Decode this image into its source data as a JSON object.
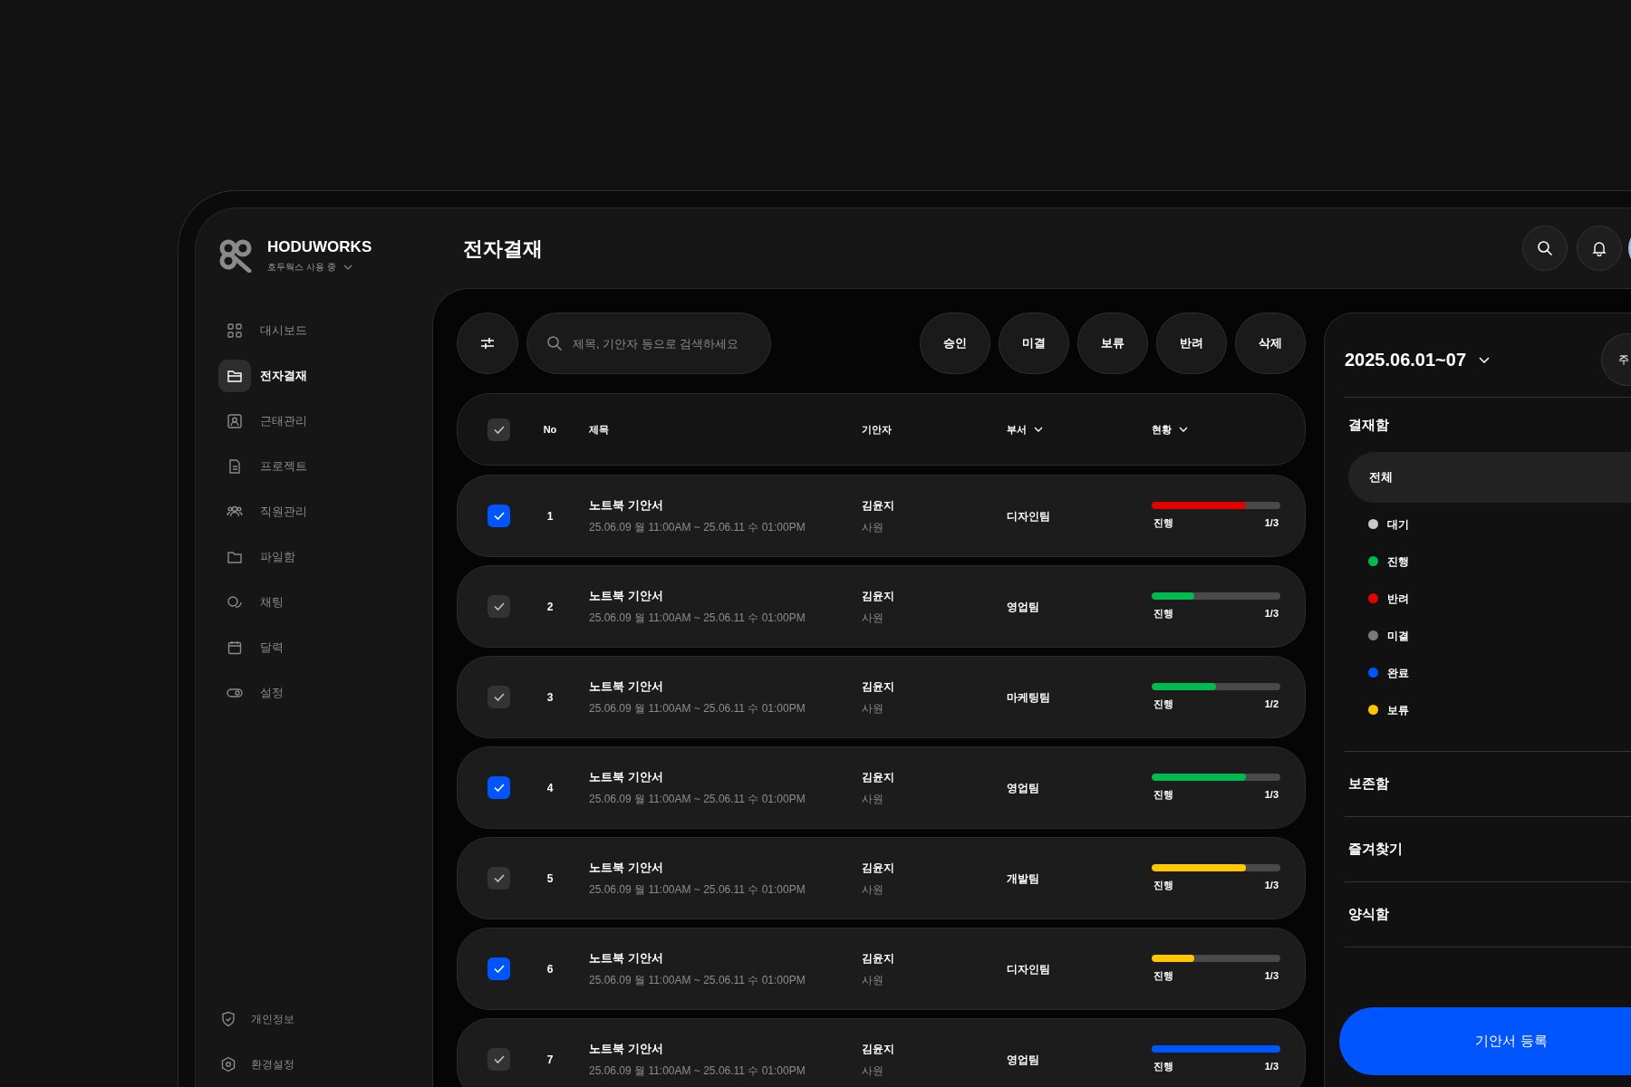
{
  "brand": {
    "name": "HODUWORKS",
    "workspace": "호두웍스 사용 중"
  },
  "sidebar": {
    "items": [
      {
        "label": "대시보드",
        "selected": false
      },
      {
        "label": "전자결재",
        "selected": true
      },
      {
        "label": "근태관리",
        "selected": false
      },
      {
        "label": "프로젝트",
        "selected": false
      },
      {
        "label": "직원관리",
        "selected": false
      },
      {
        "label": "파일함",
        "selected": false
      },
      {
        "label": "채팅",
        "selected": false
      },
      {
        "label": "달력",
        "selected": false
      },
      {
        "label": "설정",
        "selected": false
      }
    ],
    "bottom_items": [
      {
        "label": "개인정보"
      },
      {
        "label": "환경설정"
      }
    ]
  },
  "page_title": "전자결재",
  "toolbar": {
    "search": {
      "placeholder": "제목, 기안자 등으로 검색하세요"
    },
    "actions": [
      "승인",
      "미결",
      "보류",
      "반려",
      "삭제"
    ]
  },
  "table": {
    "header_selected": false,
    "columns": [
      {
        "label": "No",
        "dropdown": false
      },
      {
        "label": "제목",
        "dropdown": false
      },
      {
        "label": "기안자",
        "dropdown": false
      },
      {
        "label": "부서",
        "dropdown": true
      },
      {
        "label": "현황",
        "dropdown": true
      }
    ],
    "rows": [
      {
        "selected": true,
        "no": "1",
        "title": "노트북 기안서",
        "period": "25.06.09 월 11:00AM ~ 25.06.11 수 01:00PM",
        "drafter": "김윤지",
        "rank": "사원",
        "department": "디자인팀",
        "level": 0.73,
        "color": "#e50000",
        "status": "진행",
        "step": "1/3"
      },
      {
        "selected": false,
        "no": "2",
        "title": "노트북 기안서",
        "period": "25.06.09 월 11:00AM ~ 25.06.11 수 01:00PM",
        "drafter": "김윤지",
        "rank": "사원",
        "department": "영업팀",
        "level": 0.33,
        "color": "#00b94f",
        "status": "진행",
        "step": "1/3"
      },
      {
        "selected": false,
        "no": "3",
        "title": "노트북 기안서",
        "period": "25.06.09 월 11:00AM ~ 25.06.11 수 01:00PM",
        "drafter": "김윤지",
        "rank": "사원",
        "department": "마케팅팀",
        "level": 0.5,
        "color": "#00b94f",
        "status": "진행",
        "step": "1/2"
      },
      {
        "selected": true,
        "no": "4",
        "title": "노트북 기안서",
        "period": "25.06.09 월 11:00AM ~ 25.06.11 수 01:00PM",
        "drafter": "김윤지",
        "rank": "사원",
        "department": "영업팀",
        "level": 0.73,
        "color": "#00b94f",
        "status": "진행",
        "step": "1/3"
      },
      {
        "selected": false,
        "no": "5",
        "title": "노트북 기안서",
        "period": "25.06.09 월 11:00AM ~ 25.06.11 수 01:00PM",
        "drafter": "김윤지",
        "rank": "사원",
        "department": "개발팀",
        "level": 0.73,
        "color": "#ffc700",
        "status": "진행",
        "step": "1/3"
      },
      {
        "selected": true,
        "no": "6",
        "title": "노트북 기안서",
        "period": "25.06.09 월 11:00AM ~ 25.06.11 수 01:00PM",
        "drafter": "김윤지",
        "rank": "사원",
        "department": "디자인팀",
        "level": 0.33,
        "color": "#ffc700",
        "status": "진행",
        "step": "1/3"
      },
      {
        "selected": false,
        "no": "7",
        "title": "노트북 기안서",
        "period": "25.06.09 월 11:00AM ~ 25.06.11 수 01:00PM",
        "drafter": "김윤지",
        "rank": "사원",
        "department": "영업팀",
        "level": 1,
        "color": "#0055ff",
        "status": "진행",
        "step": "1/3"
      }
    ]
  },
  "right_panel": {
    "date_range": "2025.06.01~07",
    "period_button": "주",
    "approval_box": {
      "title": "결재함",
      "all": {
        "label": "전체",
        "selected": true
      },
      "statuses": [
        {
          "label": "대기",
          "color": "#c8c8c8"
        },
        {
          "label": "진행",
          "color": "#00b94f"
        },
        {
          "label": "반려",
          "color": "#e50000"
        },
        {
          "label": "미결",
          "color": "#7a7a7a"
        },
        {
          "label": "완료",
          "color": "#0055ff"
        },
        {
          "label": "보류",
          "color": "#ffc700"
        }
      ]
    },
    "sections": [
      "보존함",
      "즐겨찾기",
      "양식함"
    ],
    "register_button": "기안서 등록"
  }
}
